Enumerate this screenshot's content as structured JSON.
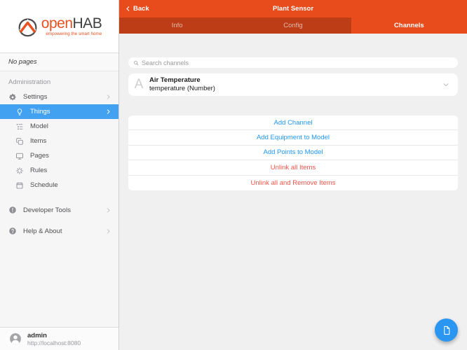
{
  "colors": {
    "navbar_orange": "#e84c1c",
    "tabbar_dark_orange": "#bd3d16",
    "sidebar_selected_blue": "#42a1f1",
    "link_blue": "#2196f3",
    "link_red": "#f2544a",
    "fab_blue": "#2b96f2"
  },
  "sidebar": {
    "brand": {
      "open": "open",
      "hab": "HAB",
      "tagline": "empowering the smart home"
    },
    "no_pages": "No pages",
    "section": "Administration",
    "items": [
      {
        "label": "Settings",
        "icon": "gear-icon"
      },
      {
        "label": "Things",
        "icon": "lightbulb-icon"
      },
      {
        "label": "Model",
        "icon": "tree-list-icon"
      },
      {
        "label": "Items",
        "icon": "copy-icon"
      },
      {
        "label": "Pages",
        "icon": "monitor-icon"
      },
      {
        "label": "Rules",
        "icon": "sparkle-icon"
      },
      {
        "label": "Schedule",
        "icon": "calendar-icon"
      }
    ],
    "tools": [
      {
        "label": "Developer Tools",
        "icon": "exclamation-circle-icon"
      },
      {
        "label": "Help & About",
        "icon": "question-circle-icon"
      }
    ],
    "user": {
      "name": "admin",
      "url": "http://localhost:8080"
    }
  },
  "header": {
    "back": "Back",
    "title": "Plant Sensor"
  },
  "tabs": [
    {
      "label": "Info"
    },
    {
      "label": "Config"
    },
    {
      "label": "Channels"
    }
  ],
  "content": {
    "search_placeholder": "Search channels",
    "channel": {
      "badge": "A",
      "title": "Air Temperature",
      "subtitle": "temperature (Number)"
    },
    "actions": [
      {
        "label": "Add Channel",
        "type": "blue"
      },
      {
        "label": "Add Equipment to Model",
        "type": "blue"
      },
      {
        "label": "Add Points to Model",
        "type": "blue"
      },
      {
        "label": "Unlink all Items",
        "type": "red"
      },
      {
        "label": "Unlink all and Remove Items",
        "type": "red"
      }
    ]
  }
}
